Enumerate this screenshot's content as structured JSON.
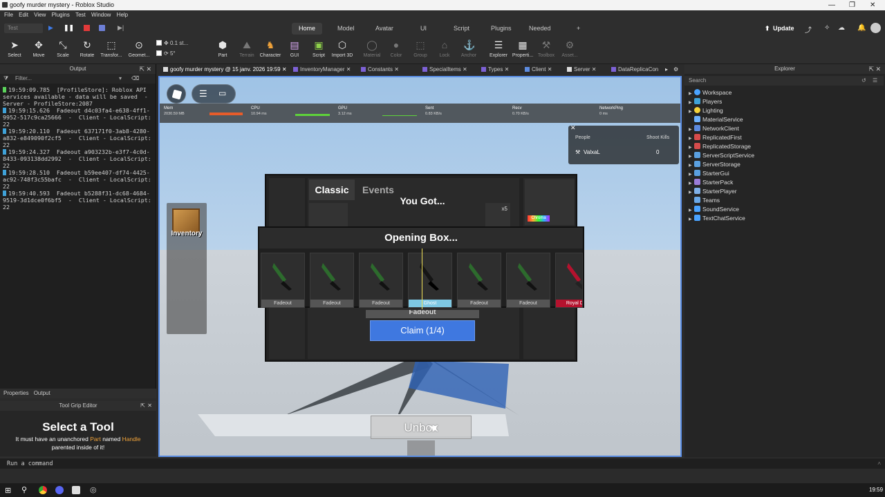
{
  "window": {
    "title": "goofy murder mystery - Roblox Studio"
  },
  "menu": [
    "File",
    "Edit",
    "View",
    "Plugins",
    "Test",
    "Window",
    "Help"
  ],
  "ribbon_tabs": {
    "items": [
      "Home",
      "Model",
      "Avatar",
      "UI",
      "Script",
      "Plugins",
      "Needed"
    ],
    "active": "Home",
    "plus": "+",
    "mode": "Test",
    "update": "Update"
  },
  "tools": [
    "Select",
    "Move",
    "Scale",
    "Rotate",
    "Transfor...",
    "Geomet...",
    "Part",
    "Terrain",
    "Character",
    "GUI",
    "Script",
    "Import 3D",
    "Material",
    "Color",
    "Group",
    "Lock",
    "Anchor",
    "Explorer",
    "Properti...",
    "Toolbox",
    "Asset..."
  ],
  "snap": {
    "move": "0.1 st...",
    "rotate": "5°"
  },
  "output": {
    "title": "Output",
    "filter_placeholder": "Filter...",
    "logs": [
      {
        "text": "19:59:09.785  [ProfileStore]: Roblox API services available - data will be saved  -  Server - ProfileStore:2087",
        "kind": "server"
      },
      {
        "text": "19:59:15.626  Fadeout d4c03fa4-e638-4ff1-9952-517c9ca25666  -  Client - LocalScript:22",
        "kind": "client"
      },
      {
        "text": "19:59:20.110  Fadeout 637171f0-3ab8-4280-a832-e849090f2cf5  -  Client - LocalScript:22",
        "kind": "client"
      },
      {
        "text": "19:59:24.327  Fadeout a903232b-e3f7-4c0d-8433-093138dd2992  -  Client - LocalScript:22",
        "kind": "client"
      },
      {
        "text": "19:59:28.510  Fadeout b59ee407-df74-4425-ac92-748f3c55bafc  -  Client - LocalScript:22",
        "kind": "client"
      },
      {
        "text": "19:59:40.593  Fadeout b5288f31-dc68-4684-9519-3d1dce0f6bf5  -  Client - LocalScript:22",
        "kind": "client"
      }
    ]
  },
  "lower_tabs": [
    "Properties",
    "Output"
  ],
  "tool_grip": {
    "title": "Tool Grip Editor",
    "heading": "Select a Tool",
    "line1_a": "It must have an unanchored ",
    "line1_part": "Part",
    "line1_b": " named ",
    "line1_handle": "Handle",
    "line2": "parented inside of it!"
  },
  "command_bar": {
    "placeholder": "Run a command"
  },
  "doc_tabs": [
    "goofy murder mystery @ 15 janv. 2026 19:59",
    "InventoryManager",
    "Constants",
    "SpecialItems",
    "Types",
    "Client",
    "Server",
    "DataReplicaCon"
  ],
  "stats": [
    {
      "label": "Mem",
      "value": "2030.59 MB"
    },
    {
      "label": "CPU",
      "value": "10.94 ms"
    },
    {
      "label": "GPU",
      "value": "3.12 ms"
    },
    {
      "label": "Sent",
      "value": "0.83 KB/s"
    },
    {
      "label": "Recv",
      "value": "0.70 KB/s"
    },
    {
      "label": "NetworkPing",
      "value": "0 ms"
    }
  ],
  "player_list": {
    "col1": "People",
    "col2": "Shoot Kills",
    "player": "ValxaL",
    "kills": "0"
  },
  "inventory_button": "Inventory",
  "shop": {
    "tab_classic": "Classic",
    "tab_events": "Events",
    "you_got": "You Got...",
    "x5": "x5",
    "chroma": "Chroma",
    "fadeout_partial": "Fadeout",
    "claim": "Claim (1/4)",
    "unbox": "Unbox"
  },
  "opening_box": {
    "title": "Opening Box...",
    "items": [
      {
        "name": "Fadeout",
        "color": "#555555"
      },
      {
        "name": "Fadeout",
        "color": "#555555"
      },
      {
        "name": "Fadeout",
        "color": "#555555"
      },
      {
        "name": "Ghost",
        "color": "#7ec8e3"
      },
      {
        "name": "Fadeout",
        "color": "#555555"
      },
      {
        "name": "Fadeout",
        "color": "#555555"
      },
      {
        "name": "Royal Dian",
        "color": "#b5122e"
      }
    ]
  },
  "explorer": {
    "title": "Explorer",
    "search_placeholder": "Search",
    "items": [
      {
        "name": "Workspace",
        "color": "#4aa3ff"
      },
      {
        "name": "Players",
        "color": "#3fa2d8"
      },
      {
        "name": "Lighting",
        "color": "#f5d33b"
      },
      {
        "name": "MaterialService",
        "color": "#6fb2ff"
      },
      {
        "name": "NetworkClient",
        "color": "#5c8adf"
      },
      {
        "name": "ReplicatedFirst",
        "color": "#d64b4b"
      },
      {
        "name": "ReplicatedStorage",
        "color": "#d64b4b"
      },
      {
        "name": "ServerScriptService",
        "color": "#5aa0e0"
      },
      {
        "name": "ServerStorage",
        "color": "#5aa0e0"
      },
      {
        "name": "StarterGui",
        "color": "#5aa0e0"
      },
      {
        "name": "StarterPack",
        "color": "#9a7cd8"
      },
      {
        "name": "StarterPlayer",
        "color": "#7fb0e8"
      },
      {
        "name": "Teams",
        "color": "#6aa8e8"
      },
      {
        "name": "SoundService",
        "color": "#4aa3ff"
      },
      {
        "name": "TextChatService",
        "color": "#4aa3ff"
      }
    ]
  },
  "clock": "19:59"
}
